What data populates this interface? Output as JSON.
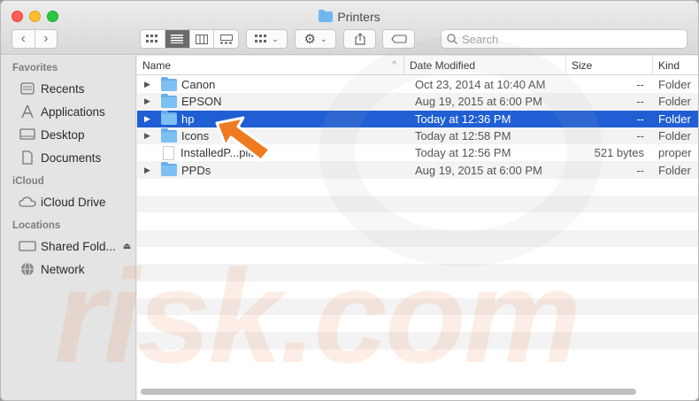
{
  "window": {
    "title": "Printers"
  },
  "toolbar": {
    "back_icon": "chevron-left-icon",
    "forward_icon": "chevron-right-icon",
    "search_placeholder": "Search"
  },
  "sidebar": {
    "sections": [
      {
        "heading": "Favorites",
        "items": [
          {
            "label": "Recents",
            "icon": "clock-icon"
          },
          {
            "label": "Applications",
            "icon": "applications-icon"
          },
          {
            "label": "Desktop",
            "icon": "desktop-icon"
          },
          {
            "label": "Documents",
            "icon": "document-icon"
          }
        ]
      },
      {
        "heading": "iCloud",
        "items": [
          {
            "label": "iCloud Drive",
            "icon": "cloud-icon"
          }
        ]
      },
      {
        "heading": "Locations",
        "items": [
          {
            "label": "Shared Fold...",
            "icon": "display-icon"
          },
          {
            "label": "Network",
            "icon": "globe-icon"
          }
        ]
      }
    ]
  },
  "columns": {
    "name": "Name",
    "date": "Date Modified",
    "size": "Size",
    "kind": "Kind"
  },
  "files": [
    {
      "name": "Canon",
      "date": "Oct 23, 2014 at 10:40 AM",
      "size": "--",
      "kind": "Folder",
      "type": "folder",
      "selected": false
    },
    {
      "name": "EPSON",
      "date": "Aug 19, 2015 at 6:00 PM",
      "size": "--",
      "kind": "Folder",
      "type": "folder",
      "selected": false
    },
    {
      "name": "hp",
      "date": "Today at 12:36 PM",
      "size": "--",
      "kind": "Folder",
      "type": "folder",
      "selected": true
    },
    {
      "name": "Icons",
      "date": "Today at 12:58 PM",
      "size": "--",
      "kind": "Folder",
      "type": "folder",
      "selected": false
    },
    {
      "name": "InstalledP...plist",
      "date": "Today at 12:56 PM",
      "size": "521 bytes",
      "kind": "proper",
      "type": "file",
      "selected": false
    },
    {
      "name": "PPDs",
      "date": "Aug 19, 2015 at 6:00 PM",
      "size": "--",
      "kind": "Folder",
      "type": "folder",
      "selected": false
    }
  ],
  "watermark": "risk.com",
  "colors": {
    "selection": "#1f5fd3",
    "arrow": "#f07a1f"
  }
}
